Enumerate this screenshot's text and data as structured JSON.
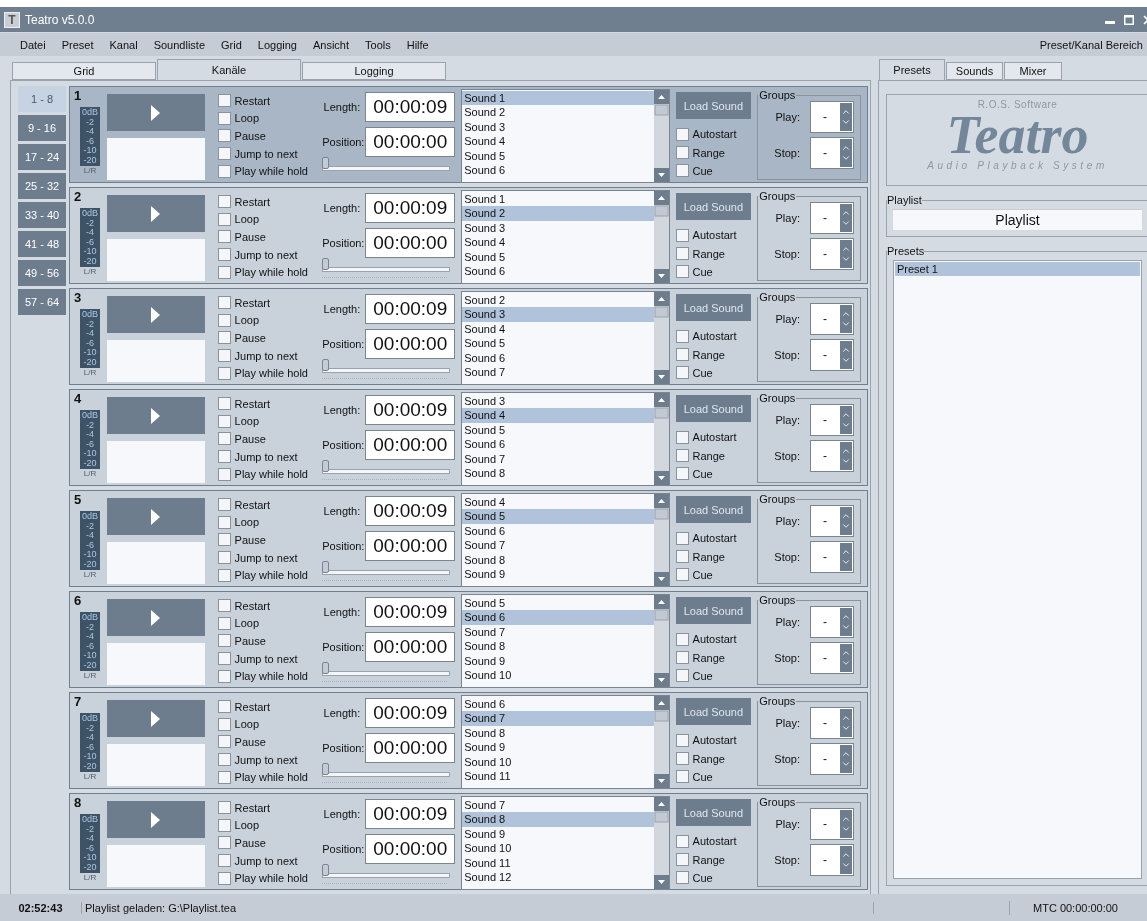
{
  "window": {
    "icon_letter": "T",
    "title": "Teatro v5.0.0"
  },
  "menu": {
    "items": [
      "Datei",
      "Preset",
      "Kanal",
      "Soundliste",
      "Grid",
      "Logging",
      "Ansicht",
      "Tools",
      "Hilfe"
    ],
    "right_label": "Preset/Kanal Bereich"
  },
  "main_tabs": [
    {
      "label": "Grid",
      "selected": false
    },
    {
      "label": "Kanäle",
      "selected": true
    },
    {
      "label": "Logging",
      "selected": false
    }
  ],
  "banks": [
    {
      "label": "1 - 8",
      "selected": true
    },
    {
      "label": "9 - 16",
      "selected": false
    },
    {
      "label": "17 - 24",
      "selected": false
    },
    {
      "label": "25 - 32",
      "selected": false
    },
    {
      "label": "33 - 40",
      "selected": false
    },
    {
      "label": "41 - 48",
      "selected": false
    },
    {
      "label": "49 - 56",
      "selected": false
    },
    {
      "label": "57 - 64",
      "selected": false
    }
  ],
  "channels": [
    {
      "number": "1",
      "active": true,
      "meter": [
        "0dB",
        "-2",
        "-4",
        "-6",
        "-10",
        "-20"
      ],
      "meter_channel": "L/R",
      "options": [
        {
          "label": "Restart",
          "checked": false
        },
        {
          "label": "Loop",
          "checked": false
        },
        {
          "label": "Pause",
          "checked": false
        },
        {
          "label": "Jump to next",
          "checked": false
        },
        {
          "label": "Play while hold",
          "checked": false
        }
      ],
      "length_label": "Length:",
      "length": "00:00:09",
      "position_label": "Position:",
      "position": "00:00:00",
      "position_slider": {
        "level": 0
      },
      "sounds": [
        {
          "label": "Sound 1",
          "selected": true
        },
        {
          "label": "Sound 2",
          "selected": false
        },
        {
          "label": "Sound 3",
          "selected": false
        },
        {
          "label": "Sound 4",
          "selected": false
        },
        {
          "label": "Sound 5",
          "selected": false
        },
        {
          "label": "Sound 6",
          "selected": false
        }
      ],
      "load_button": "Load Sound",
      "flags": [
        {
          "label": "Autostart",
          "checked": false
        },
        {
          "label": "Range",
          "checked": false
        },
        {
          "label": "Cue",
          "checked": false
        }
      ],
      "groups": {
        "title": "Groups",
        "play_label": "Play:",
        "play": "-",
        "stop_label": "Stop:",
        "stop": "-"
      }
    },
    {
      "number": "2",
      "active": false,
      "meter": [
        "0dB",
        "-2",
        "-4",
        "-6",
        "-10",
        "-20"
      ],
      "meter_channel": "L/R",
      "options": [
        {
          "label": "Restart",
          "checked": false
        },
        {
          "label": "Loop",
          "checked": false
        },
        {
          "label": "Pause",
          "checked": false
        },
        {
          "label": "Jump to next",
          "checked": false
        },
        {
          "label": "Play while hold",
          "checked": false
        }
      ],
      "length_label": "Length:",
      "length": "00:00:09",
      "position_label": "Position:",
      "position": "00:00:00",
      "position_slider": {
        "level": 0
      },
      "sounds": [
        {
          "label": "Sound 1",
          "selected": false
        },
        {
          "label": "Sound 2",
          "selected": true
        },
        {
          "label": "Sound 3",
          "selected": false
        },
        {
          "label": "Sound 4",
          "selected": false
        },
        {
          "label": "Sound 5",
          "selected": false
        },
        {
          "label": "Sound 6",
          "selected": false
        }
      ],
      "load_button": "Load Sound",
      "flags": [
        {
          "label": "Autostart",
          "checked": false
        },
        {
          "label": "Range",
          "checked": false
        },
        {
          "label": "Cue",
          "checked": false
        }
      ],
      "groups": {
        "title": "Groups",
        "play_label": "Play:",
        "play": "-",
        "stop_label": "Stop:",
        "stop": "-"
      }
    },
    {
      "number": "3",
      "active": false,
      "meter": [
        "0dB",
        "-2",
        "-4",
        "-6",
        "-10",
        "-20"
      ],
      "meter_channel": "L/R",
      "options": [
        {
          "label": "Restart",
          "checked": false
        },
        {
          "label": "Loop",
          "checked": false
        },
        {
          "label": "Pause",
          "checked": false
        },
        {
          "label": "Jump to next",
          "checked": false
        },
        {
          "label": "Play while hold",
          "checked": false
        }
      ],
      "length_label": "Length:",
      "length": "00:00:09",
      "position_label": "Position:",
      "position": "00:00:00",
      "position_slider": {
        "level": 0
      },
      "sounds": [
        {
          "label": "Sound 2",
          "selected": false
        },
        {
          "label": "Sound 3",
          "selected": true
        },
        {
          "label": "Sound 4",
          "selected": false
        },
        {
          "label": "Sound 5",
          "selected": false
        },
        {
          "label": "Sound 6",
          "selected": false
        },
        {
          "label": "Sound 7",
          "selected": false
        }
      ],
      "load_button": "Load Sound",
      "flags": [
        {
          "label": "Autostart",
          "checked": false
        },
        {
          "label": "Range",
          "checked": false
        },
        {
          "label": "Cue",
          "checked": false
        }
      ],
      "groups": {
        "title": "Groups",
        "play_label": "Play:",
        "play": "-",
        "stop_label": "Stop:",
        "stop": "-"
      }
    },
    {
      "number": "4",
      "active": false,
      "meter": [
        "0dB",
        "-2",
        "-4",
        "-6",
        "-10",
        "-20"
      ],
      "meter_channel": "L/R",
      "options": [
        {
          "label": "Restart",
          "checked": false
        },
        {
          "label": "Loop",
          "checked": false
        },
        {
          "label": "Pause",
          "checked": false
        },
        {
          "label": "Jump to next",
          "checked": false
        },
        {
          "label": "Play while hold",
          "checked": false
        }
      ],
      "length_label": "Length:",
      "length": "00:00:09",
      "position_label": "Position:",
      "position": "00:00:00",
      "position_slider": {
        "level": 0
      },
      "sounds": [
        {
          "label": "Sound 3",
          "selected": false
        },
        {
          "label": "Sound 4",
          "selected": true
        },
        {
          "label": "Sound 5",
          "selected": false
        },
        {
          "label": "Sound 6",
          "selected": false
        },
        {
          "label": "Sound 7",
          "selected": false
        },
        {
          "label": "Sound 8",
          "selected": false
        }
      ],
      "load_button": "Load Sound",
      "flags": [
        {
          "label": "Autostart",
          "checked": false
        },
        {
          "label": "Range",
          "checked": false
        },
        {
          "label": "Cue",
          "checked": false
        }
      ],
      "groups": {
        "title": "Groups",
        "play_label": "Play:",
        "play": "-",
        "stop_label": "Stop:",
        "stop": "-"
      }
    },
    {
      "number": "5",
      "active": false,
      "meter": [
        "0dB",
        "-2",
        "-4",
        "-6",
        "-10",
        "-20"
      ],
      "meter_channel": "L/R",
      "options": [
        {
          "label": "Restart",
          "checked": false
        },
        {
          "label": "Loop",
          "checked": false
        },
        {
          "label": "Pause",
          "checked": false
        },
        {
          "label": "Jump to next",
          "checked": false
        },
        {
          "label": "Play while hold",
          "checked": false
        }
      ],
      "length_label": "Length:",
      "length": "00:00:09",
      "position_label": "Position:",
      "position": "00:00:00",
      "position_slider": {
        "level": 0
      },
      "sounds": [
        {
          "label": "Sound 4",
          "selected": false
        },
        {
          "label": "Sound 5",
          "selected": true
        },
        {
          "label": "Sound 6",
          "selected": false
        },
        {
          "label": "Sound 7",
          "selected": false
        },
        {
          "label": "Sound 8",
          "selected": false
        },
        {
          "label": "Sound 9",
          "selected": false
        }
      ],
      "load_button": "Load Sound",
      "flags": [
        {
          "label": "Autostart",
          "checked": false
        },
        {
          "label": "Range",
          "checked": false
        },
        {
          "label": "Cue",
          "checked": false
        }
      ],
      "groups": {
        "title": "Groups",
        "play_label": "Play:",
        "play": "-",
        "stop_label": "Stop:",
        "stop": "-"
      }
    },
    {
      "number": "6",
      "active": false,
      "meter": [
        "0dB",
        "-2",
        "-4",
        "-6",
        "-10",
        "-20"
      ],
      "meter_channel": "L/R",
      "options": [
        {
          "label": "Restart",
          "checked": false
        },
        {
          "label": "Loop",
          "checked": false
        },
        {
          "label": "Pause",
          "checked": false
        },
        {
          "label": "Jump to next",
          "checked": false
        },
        {
          "label": "Play while hold",
          "checked": false
        }
      ],
      "length_label": "Length:",
      "length": "00:00:09",
      "position_label": "Position:",
      "position": "00:00:00",
      "position_slider": {
        "level": 0
      },
      "sounds": [
        {
          "label": "Sound 5",
          "selected": false
        },
        {
          "label": "Sound 6",
          "selected": true
        },
        {
          "label": "Sound 7",
          "selected": false
        },
        {
          "label": "Sound 8",
          "selected": false
        },
        {
          "label": "Sound 9",
          "selected": false
        },
        {
          "label": "Sound 10",
          "selected": false
        }
      ],
      "load_button": "Load Sound",
      "flags": [
        {
          "label": "Autostart",
          "checked": false
        },
        {
          "label": "Range",
          "checked": false
        },
        {
          "label": "Cue",
          "checked": false
        }
      ],
      "groups": {
        "title": "Groups",
        "play_label": "Play:",
        "play": "-",
        "stop_label": "Stop:",
        "stop": "-"
      }
    },
    {
      "number": "7",
      "active": false,
      "meter": [
        "0dB",
        "-2",
        "-4",
        "-6",
        "-10",
        "-20"
      ],
      "meter_channel": "L/R",
      "options": [
        {
          "label": "Restart",
          "checked": false
        },
        {
          "label": "Loop",
          "checked": false
        },
        {
          "label": "Pause",
          "checked": false
        },
        {
          "label": "Jump to next",
          "checked": false
        },
        {
          "label": "Play while hold",
          "checked": false
        }
      ],
      "length_label": "Length:",
      "length": "00:00:09",
      "position_label": "Position:",
      "position": "00:00:00",
      "position_slider": {
        "level": 0
      },
      "sounds": [
        {
          "label": "Sound 6",
          "selected": false
        },
        {
          "label": "Sound 7",
          "selected": true
        },
        {
          "label": "Sound 8",
          "selected": false
        },
        {
          "label": "Sound 9",
          "selected": false
        },
        {
          "label": "Sound 10",
          "selected": false
        },
        {
          "label": "Sound 11",
          "selected": false
        }
      ],
      "load_button": "Load Sound",
      "flags": [
        {
          "label": "Autostart",
          "checked": false
        },
        {
          "label": "Range",
          "checked": false
        },
        {
          "label": "Cue",
          "checked": false
        }
      ],
      "groups": {
        "title": "Groups",
        "play_label": "Play:",
        "play": "-",
        "stop_label": "Stop:",
        "stop": "-"
      }
    },
    {
      "number": "8",
      "active": false,
      "meter": [
        "0dB",
        "-2",
        "-4",
        "-6",
        "-10",
        "-20"
      ],
      "meter_channel": "L/R",
      "options": [
        {
          "label": "Restart",
          "checked": false
        },
        {
          "label": "Loop",
          "checked": false
        },
        {
          "label": "Pause",
          "checked": false
        },
        {
          "label": "Jump to next",
          "checked": false
        },
        {
          "label": "Play while hold",
          "checked": false
        }
      ],
      "length_label": "Length:",
      "length": "00:00:09",
      "position_label": "Position:",
      "position": "00:00:00",
      "position_slider": {
        "level": 0
      },
      "sounds": [
        {
          "label": "Sound 7",
          "selected": false
        },
        {
          "label": "Sound 8",
          "selected": true
        },
        {
          "label": "Sound 9",
          "selected": false
        },
        {
          "label": "Sound 10",
          "selected": false
        },
        {
          "label": "Sound 11",
          "selected": false
        },
        {
          "label": "Sound 12",
          "selected": false
        }
      ],
      "load_button": "Load Sound",
      "flags": [
        {
          "label": "Autostart",
          "checked": false
        },
        {
          "label": "Range",
          "checked": false
        },
        {
          "label": "Cue",
          "checked": false
        }
      ],
      "groups": {
        "title": "Groups",
        "play_label": "Play:",
        "play": "-",
        "stop_label": "Stop:",
        "stop": "-"
      }
    }
  ],
  "side_tabs": [
    {
      "label": "Presets",
      "selected": true
    },
    {
      "label": "Sounds",
      "selected": false
    },
    {
      "label": "Mixer",
      "selected": false
    }
  ],
  "logo": {
    "company": "R.O.S. Software",
    "name": "Teatro",
    "tagline": "Audio Playback System"
  },
  "playlist": {
    "title": "Playlist",
    "value": "Playlist"
  },
  "presets": {
    "title": "Presets",
    "items": [
      {
        "label": "Preset 1",
        "selected": true
      }
    ]
  },
  "status_bar": {
    "time": "02:52:43",
    "message": "Playlist geladen: G:\\Playlist.tea",
    "mtc": "MTC 00:00:00:00"
  }
}
